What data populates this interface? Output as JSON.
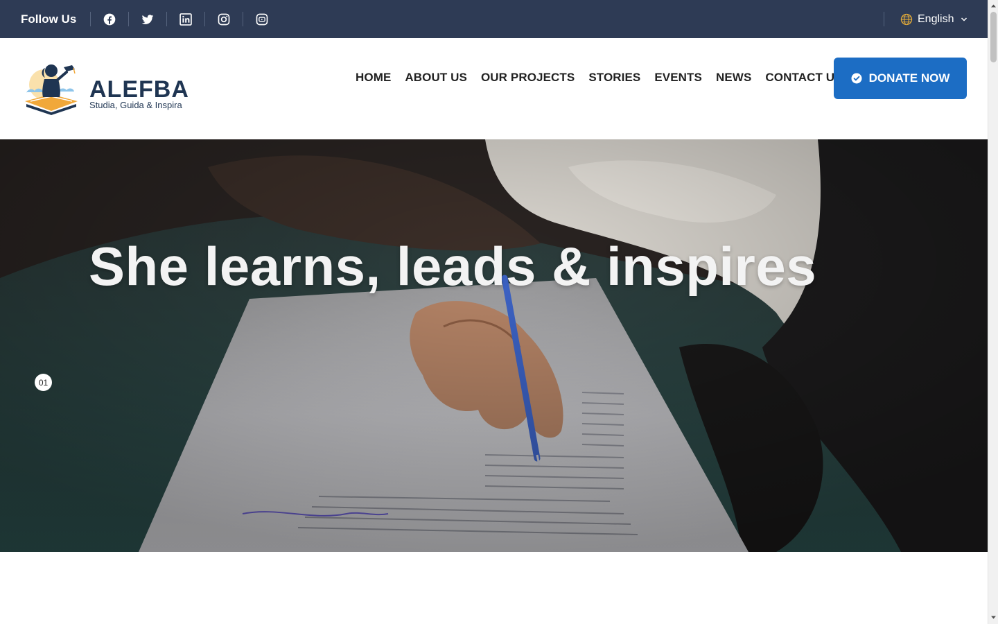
{
  "topbar": {
    "follow_label": "Follow Us",
    "socials": [
      {
        "icon": "facebook-icon"
      },
      {
        "icon": "twitter-icon"
      },
      {
        "icon": "linkedin-icon"
      },
      {
        "icon": "instagram-icon"
      },
      {
        "icon": "youtube-icon"
      }
    ],
    "language": "English"
  },
  "header": {
    "logo": {
      "name": "ALEFBA",
      "tagline": "Studia, Guida & Inspira"
    },
    "nav": [
      "HOME",
      "ABOUT US",
      "OUR PROJECTS",
      "STORIES",
      "EVENTS",
      "NEWS",
      "CONTACT US"
    ],
    "donate_label": "DONATE NOW"
  },
  "hero": {
    "title": "She learns, leads & inspires",
    "slide_number": "01"
  },
  "colors": {
    "topbar_bg": "#2e3b55",
    "accent": "#1c6dc4",
    "brand": "#1f3552",
    "logo_orange": "#f1a83a"
  }
}
